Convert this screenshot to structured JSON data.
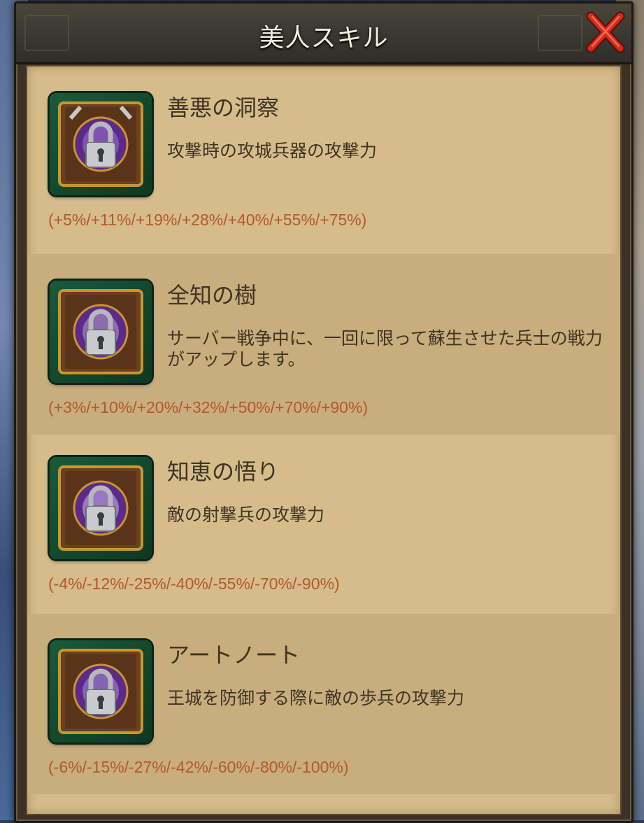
{
  "header": {
    "title": "美人スキル",
    "close_icon": "close-x-icon"
  },
  "colors": {
    "panel_bg": "#d5bc8a",
    "row_alt_bg": "#c8ad7d",
    "text": "#3f3424",
    "value_text": "#b6582a",
    "close_red": "#d42a1c"
  },
  "skills": [
    {
      "name": "善悪の洞察",
      "description": "攻撃時の攻城兵器の攻撃力",
      "values": "(+5%/+11%/+19%/+28%/+40%/+55%/+75%)",
      "icon": "locked-skill-book-icon",
      "locked": true
    },
    {
      "name": "全知の樹",
      "description": "サーバー戦争中に、一回に限って蘇生させた兵士の戦力がアップします。",
      "values": "(+3%/+10%/+20%/+32%/+50%/+70%/+90%)",
      "icon": "locked-skill-book-icon",
      "locked": true
    },
    {
      "name": "知恵の悟り",
      "description": "敵の射撃兵の攻撃力",
      "values": "(-4%/-12%/-25%/-40%/-55%/-70%/-90%)",
      "icon": "locked-skill-book-icon",
      "locked": true
    },
    {
      "name": "アートノート",
      "description": "王城を防御する際に敵の歩兵の攻撃力",
      "values": "(-6%/-15%/-27%/-42%/-60%/-80%/-100%)",
      "icon": "locked-skill-book-icon",
      "locked": true
    }
  ]
}
